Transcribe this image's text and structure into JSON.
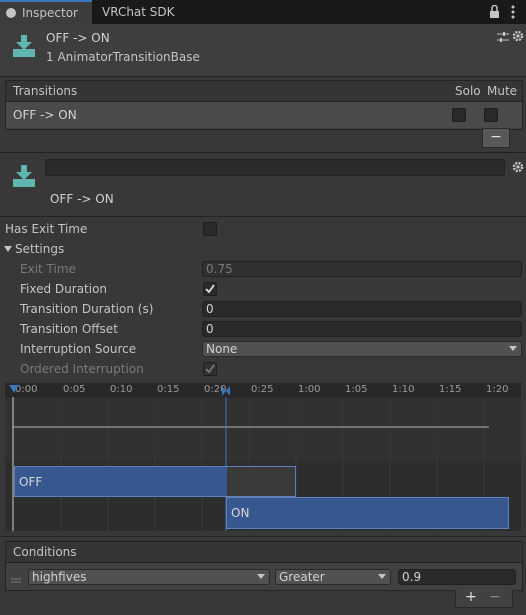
{
  "tabs": {
    "inspector": "Inspector",
    "vrchat_sdk": "VRChat SDK"
  },
  "header": {
    "title": "OFF -> ON",
    "subtitle": "1 AnimatorTransitionBase"
  },
  "transitions": {
    "label": "Transitions",
    "solo": "Solo",
    "mute": "Mute",
    "rows": [
      {
        "name": "OFF -> ON"
      }
    ],
    "remove_label": "−"
  },
  "transition": {
    "name_value": "",
    "label": "OFF -> ON"
  },
  "props": {
    "has_exit_time": "Has Exit Time",
    "settings": "Settings",
    "exit_time": "Exit Time",
    "exit_time_value": "0.75",
    "fixed_duration": "Fixed Duration",
    "transition_duration": "Transition Duration (s)",
    "transition_duration_value": "0",
    "transition_offset": "Transition Offset",
    "transition_offset_value": "0",
    "interruption_source": "Interruption Source",
    "interruption_source_value": "None",
    "ordered_interruption": "Ordered Interruption"
  },
  "timeline": {
    "ticks": [
      "0:00",
      "0:05",
      "0:10",
      "0:15",
      "0:20",
      "0:25",
      "1:00",
      "1:05",
      "1:10",
      "1:15",
      "1:20"
    ],
    "off_label": "OFF",
    "on_label": "ON"
  },
  "conditions": {
    "label": "Conditions",
    "param": "highfives",
    "mode": "Greater",
    "threshold": "0.9",
    "add": "+",
    "remove": "−"
  },
  "colors": {
    "accent": "#3a79bb",
    "bar": "#37588f"
  }
}
